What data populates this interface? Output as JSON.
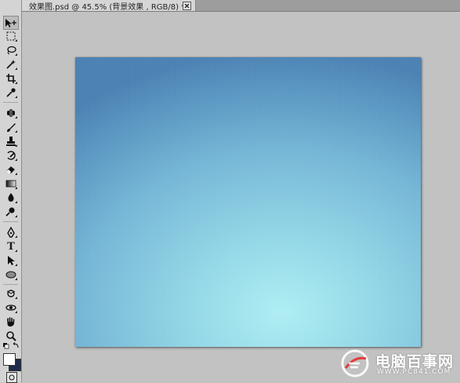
{
  "document_tab": {
    "title": "效果图.psd @ 45.5% (背景效果 , RGB/8) *",
    "close_icon": "close-icon"
  },
  "toolbar": {
    "tools": [
      {
        "name": "move-tool",
        "icon": "move-icon",
        "selected": true
      },
      {
        "name": "marquee-tool",
        "icon": "marquee-icon"
      },
      {
        "name": "lasso-tool",
        "icon": "lasso-icon"
      },
      {
        "name": "magic-wand-tool",
        "icon": "magic-wand-icon"
      },
      {
        "name": "crop-tool",
        "icon": "crop-icon"
      },
      {
        "name": "eyedropper-tool",
        "icon": "eyedropper-icon"
      },
      {
        "name": "healing-brush-tool",
        "icon": "healing-brush-icon"
      },
      {
        "name": "brush-tool",
        "icon": "brush-icon"
      },
      {
        "name": "clone-stamp-tool",
        "icon": "stamp-icon"
      },
      {
        "name": "history-brush-tool",
        "icon": "history-brush-icon"
      },
      {
        "name": "eraser-tool",
        "icon": "eraser-icon"
      },
      {
        "name": "gradient-tool",
        "icon": "gradient-icon"
      },
      {
        "name": "blur-tool",
        "icon": "blur-icon"
      },
      {
        "name": "dodge-tool",
        "icon": "dodge-icon"
      },
      {
        "name": "pen-tool",
        "icon": "pen-icon"
      },
      {
        "name": "type-tool",
        "icon": "type-icon",
        "glyph": "T"
      },
      {
        "name": "path-selection-tool",
        "icon": "path-selection-icon"
      },
      {
        "name": "shape-tool",
        "icon": "ellipse-icon"
      },
      {
        "name": "3d-rotate-tool",
        "icon": "3d-rotate-icon"
      },
      {
        "name": "3d-orbit-tool",
        "icon": "3d-orbit-icon"
      },
      {
        "name": "hand-tool",
        "icon": "hand-icon"
      },
      {
        "name": "zoom-tool",
        "icon": "zoom-icon"
      }
    ],
    "foreground_color": "#ffffff",
    "background_color": "#1c2a4a"
  },
  "canvas": {
    "layer": "背景效果",
    "colors": {
      "edge": "#4b82b3",
      "center": "#aeeef3"
    }
  },
  "watermark": {
    "text": "电脑百事网",
    "url": "WWW.PC841.COM"
  }
}
